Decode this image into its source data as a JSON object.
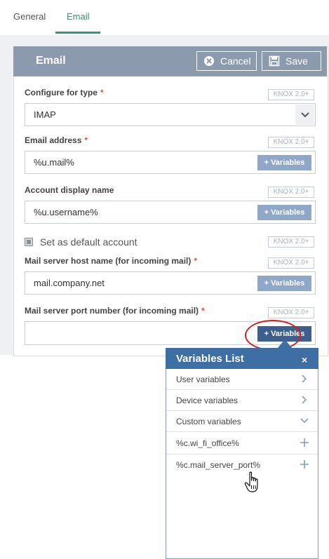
{
  "tabs": [
    {
      "label": "General",
      "active": false
    },
    {
      "label": "Email",
      "active": true
    }
  ],
  "card": {
    "title": "Email",
    "cancel_label": "Cancel",
    "save_label": "Save"
  },
  "knox_badge": "KNOX 2.0+",
  "required_mark": "*",
  "variables_button_label": "+ Variables",
  "fields": {
    "type": {
      "label": "Configure for type",
      "value": "IMAP"
    },
    "email_address": {
      "label": "Email address",
      "value": "%u.mail%"
    },
    "display_name": {
      "label": "Account display name",
      "value": "%u.username%"
    },
    "default_account": {
      "label": "Set as default account",
      "checked": true
    },
    "host_name": {
      "label": "Mail server host name (for incoming mail)",
      "value": "mail.company.net"
    },
    "port_number": {
      "label": "Mail server port number (for incoming mail)",
      "value": ""
    }
  },
  "variables_popup": {
    "title": "Variables List",
    "close": "×",
    "groups": [
      {
        "label": "User variables",
        "state": "collapsed"
      },
      {
        "label": "Device variables",
        "state": "collapsed"
      },
      {
        "label": "Custom variables",
        "state": "expanded"
      }
    ],
    "items": [
      {
        "label": "%c.wi_fi_office%"
      },
      {
        "label": "%c.mail_server_port%"
      }
    ]
  },
  "colors": {
    "accent": "#2a9a7a",
    "header": "#8c9aad",
    "popup_header": "#3d6fa5",
    "variables_button": "#8fa8c9",
    "variables_button_active": "#3d5f8f",
    "highlight": "#d61f1f",
    "required": "#d9534f"
  }
}
